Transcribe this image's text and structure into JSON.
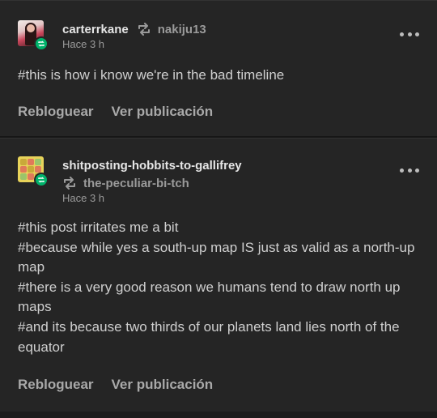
{
  "colors": {
    "background": "#1c1c1c",
    "card": "#252525",
    "reblog_green": "#00b26a",
    "text": "#cfcfcf",
    "muted": "#9a9a9a"
  },
  "posts": [
    {
      "username": "carterrkane",
      "reblogged_from": "nakiju13",
      "timestamp": "Hace 3 h",
      "tags": [
        "#this is how i know we're in the bad timeline"
      ],
      "actions": {
        "reblog": "Rebloguear",
        "view": "Ver publicación"
      }
    },
    {
      "username": "shitposting-hobbits-to-gallifrey",
      "reblogged_from": "the-peculiar-bi-tch",
      "timestamp": "Hace 3 h",
      "tags": [
        "#this post irritates me a bit",
        "#because while yes a south-up map IS just as valid as a north-up map",
        "#there is a very good reason we humans tend to draw north up maps",
        "#and its because two thirds of our planets land lies north of the equator"
      ],
      "actions": {
        "reblog": "Rebloguear",
        "view": "Ver publicación"
      }
    }
  ],
  "icons": {
    "reblog": "reblog-icon",
    "more": "more-options-icon"
  }
}
